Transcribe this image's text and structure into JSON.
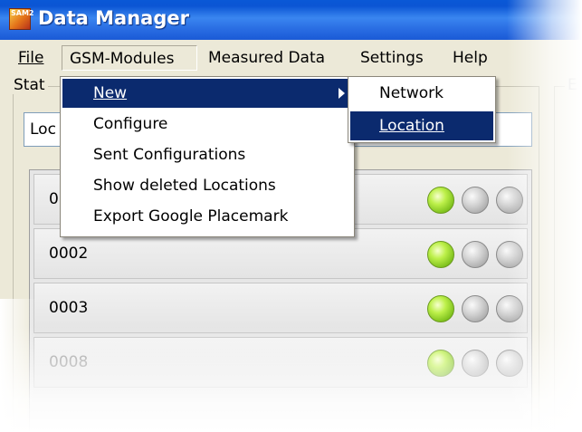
{
  "window": {
    "title": "Data Manager",
    "icon": "app-logo-icon",
    "icon_text": "SAM2"
  },
  "menubar": {
    "items": [
      {
        "label": "File"
      },
      {
        "label": "GSM-Modules"
      },
      {
        "label": "Measured Data"
      },
      {
        "label": "Settings"
      },
      {
        "label": "Help"
      }
    ],
    "active": "GSM-Modules"
  },
  "left_panel": {
    "legend": "Stat"
  },
  "right_panel": {
    "legend": "E"
  },
  "search": {
    "value": "Loc"
  },
  "locations": [
    {
      "label": "0",
      "leds": [
        "green",
        "gray",
        "gray"
      ]
    },
    {
      "label": "0002",
      "leds": [
        "green",
        "gray",
        "gray"
      ]
    },
    {
      "label": "0003",
      "leds": [
        "green",
        "gray",
        "gray"
      ]
    },
    {
      "label": "0008",
      "leds": [
        "green",
        "gray",
        "gray"
      ]
    }
  ],
  "gsm_menu": {
    "items": [
      {
        "label": "New",
        "highlighted": true,
        "has_submenu": true
      },
      {
        "label": "Configure"
      },
      {
        "label": "Sent Configurations"
      },
      {
        "label": "Show deleted Locations"
      },
      {
        "label": "Export Google Placemark"
      }
    ]
  },
  "new_submenu": {
    "items": [
      {
        "label": "Network"
      },
      {
        "label": "Location",
        "highlighted": true
      }
    ]
  },
  "colors": {
    "titlebar": "#2b6fe4",
    "highlight": "#0b2a6e",
    "led_green": "#7dc01c",
    "led_gray": "#a9a9a9"
  }
}
